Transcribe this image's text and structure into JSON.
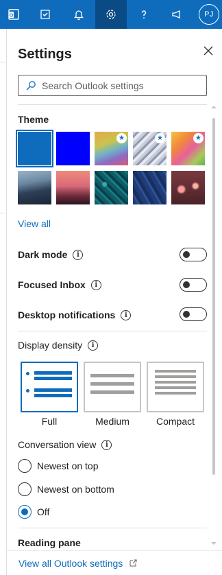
{
  "topbar": {
    "icons": [
      "office-apps-icon",
      "todo-icon",
      "bell-icon",
      "gear-icon",
      "help-icon",
      "megaphone-icon"
    ],
    "avatar_initials": "PJ"
  },
  "settings": {
    "title": "Settings",
    "search_placeholder": "Search Outlook settings",
    "theme": {
      "label": "Theme",
      "view_all": "View all",
      "selected_index": 0
    },
    "dark_mode": {
      "label": "Dark mode",
      "on": false
    },
    "focused_inbox": {
      "label": "Focused Inbox",
      "on": false
    },
    "desktop_notifications": {
      "label": "Desktop notifications",
      "on": false
    },
    "display_density": {
      "label": "Display density",
      "options": [
        "Full",
        "Medium",
        "Compact"
      ],
      "selected": "Full"
    },
    "conversation_view": {
      "label": "Conversation view",
      "options": [
        "Newest on top",
        "Newest on bottom",
        "Off"
      ],
      "selected": "Off"
    },
    "reading_pane": {
      "label": "Reading pane"
    },
    "footer_link": "View all Outlook settings"
  },
  "colors": {
    "accent": "#0f6cbd",
    "selected_theme": "#0f6cbd",
    "blue_theme": "#0000ff"
  }
}
